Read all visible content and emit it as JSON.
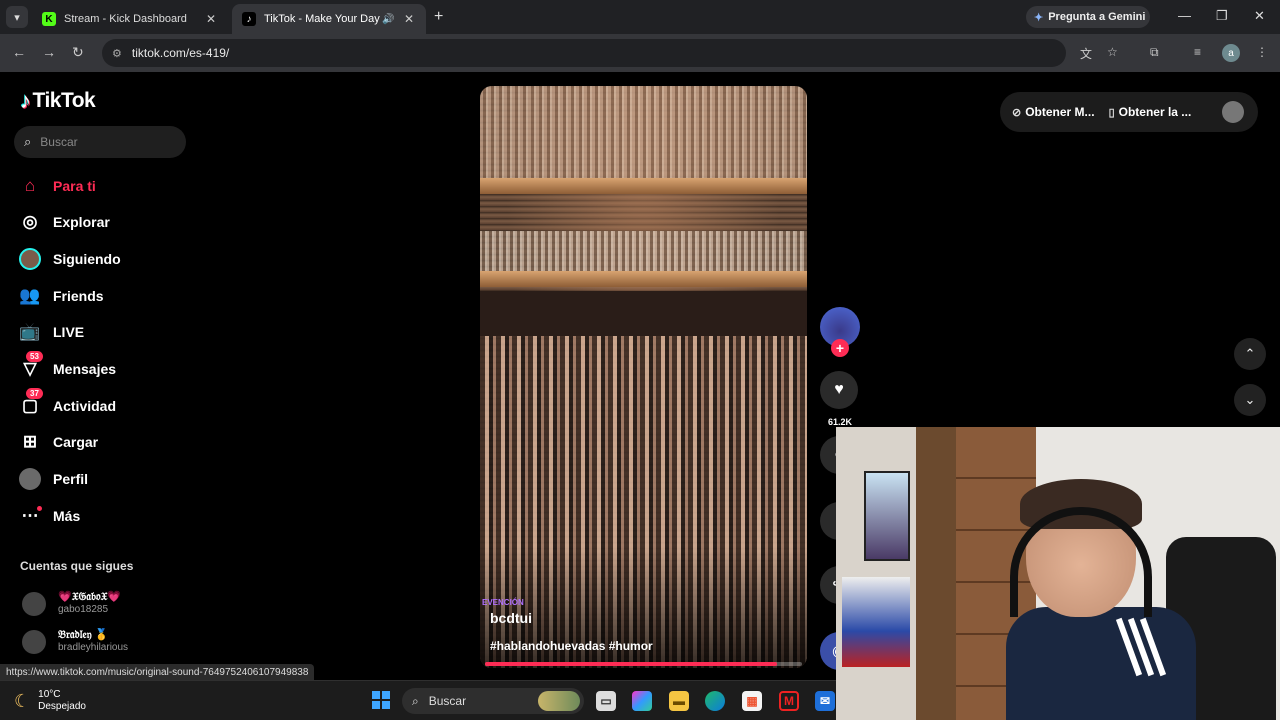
{
  "browser": {
    "tabs": [
      {
        "title": "Stream - Kick Dashboard",
        "favicon": "K"
      },
      {
        "title": "TikTok - Make Your Day",
        "favicon": "♪"
      }
    ],
    "gemini_label": "Pregunta a Gemini",
    "url": "tiktok.com/es-419/",
    "profile_initial": "a"
  },
  "tiktok": {
    "logo": "TikTok",
    "search_placeholder": "Buscar",
    "nav": [
      {
        "label": "Para ti",
        "icon": "home-icon"
      },
      {
        "label": "Explorar",
        "icon": "compass-icon"
      },
      {
        "label": "Siguiendo",
        "icon": "following-avatar"
      },
      {
        "label": "Friends",
        "icon": "friends-icon"
      },
      {
        "label": "LIVE",
        "icon": "live-icon"
      },
      {
        "label": "Mensajes",
        "icon": "messages-icon",
        "badge": "53"
      },
      {
        "label": "Actividad",
        "icon": "activity-icon",
        "badge": "37"
      },
      {
        "label": "Cargar",
        "icon": "upload-icon"
      },
      {
        "label": "Perfil",
        "icon": "profile-avatar"
      },
      {
        "label": "Más",
        "icon": "more-icon"
      }
    ],
    "following_title": "Cuentas que sigues",
    "following": [
      {
        "name": "💗𝔛𝔊𝔞𝔟𝔬𝔛💗",
        "handle": "gabo18285"
      },
      {
        "name": "𝔅𝔯𝔞𝔡𝔩𝔢𝔶 🥇",
        "handle": "bradleyhilarious"
      }
    ],
    "top_right": {
      "get_app1": "Obtener M...",
      "get_app2": "Obtener la ..."
    },
    "video": {
      "overlay_tag": "EVENCIÓN",
      "username": "bcdtui",
      "caption": "#hablandohuevadas #humor",
      "progress": 0.92
    },
    "actions": {
      "likes": "61.2K"
    },
    "status_link": "https://www.tiktok.com/music/original-sound-7649752406107949838"
  },
  "taskbar": {
    "temperature": "10°C",
    "weather": "Despejado",
    "search_label": "Buscar"
  },
  "colors": {
    "accent": "#fe2c55",
    "bg": "#000000"
  }
}
